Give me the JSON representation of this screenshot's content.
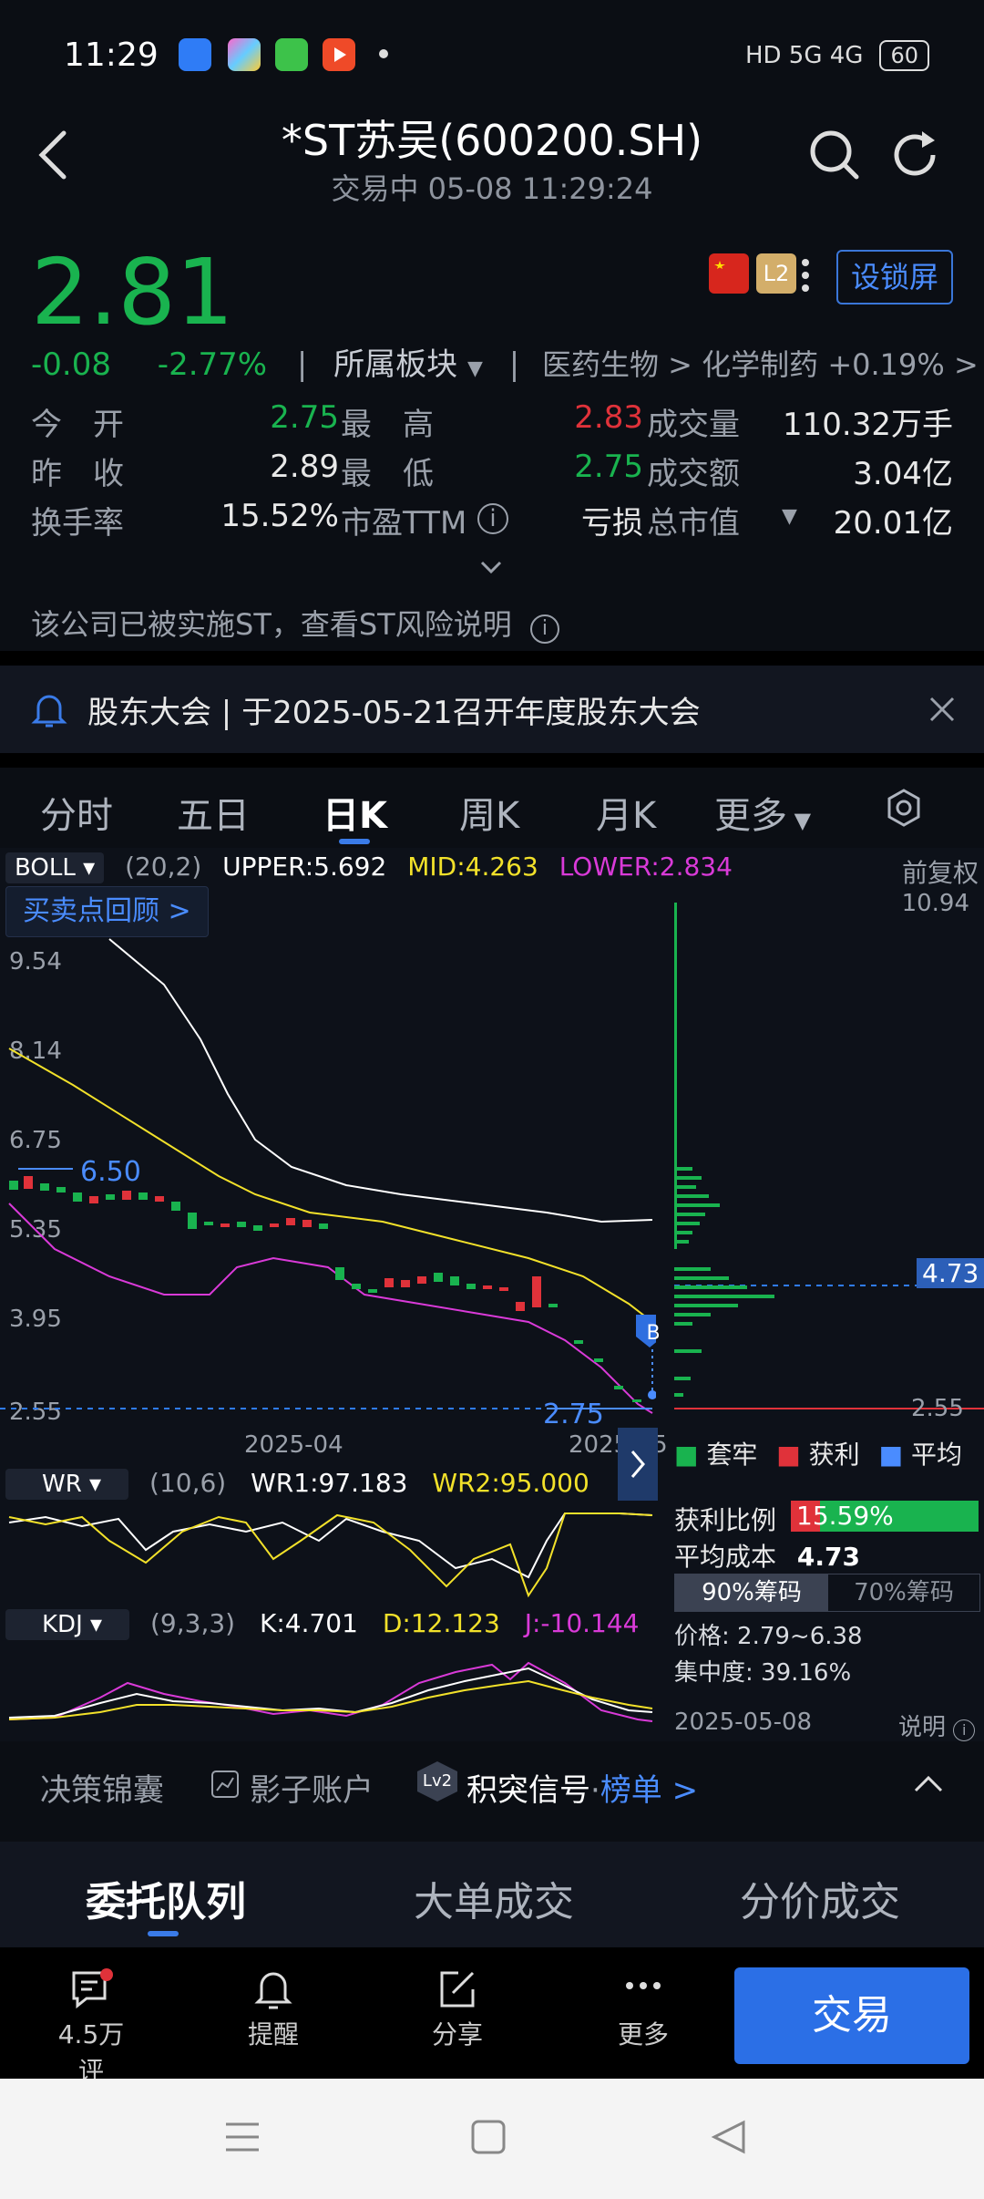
{
  "status_bar": {
    "time": "11:29",
    "network": "HD 5G 4G",
    "battery": "60",
    "app_icons": [
      "blue-app-icon",
      "colorful-app-icon",
      "green-app-icon",
      "red-video-app-icon",
      "dot-icon"
    ]
  },
  "header": {
    "title": "*ST苏吴(600200.SH)",
    "subtitle": "交易中 05-08 11:29:24"
  },
  "quote": {
    "price": "2.81",
    "change": "-0.08",
    "change_pct": "-2.77%",
    "sector_label": "所属板块",
    "sector_path": "医药生物 > 化学制药 +0.19% >",
    "l2_badge": "L2",
    "lock_screen": "设锁屏",
    "rows": [
      {
        "l1": "今　开",
        "v1": "2.75",
        "l2": "最　高",
        "v2": "2.83",
        "l3": "成交量",
        "v3": "110.32万手"
      },
      {
        "l1": "昨　收",
        "v1": "2.89",
        "l2": "最　低",
        "v2": "2.75",
        "l3": "成交额",
        "v3": "3.04亿"
      },
      {
        "l1": "换手率",
        "v1": "15.52%",
        "l2": "市盈TTM",
        "v2": "亏损",
        "l3": "总市值",
        "v3": "20.01亿"
      }
    ],
    "st_notice": "该公司已被实施ST，查看ST风险说明"
  },
  "meeting": {
    "text": "股东大会 | 于2025-05-21召开年度股东大会"
  },
  "tabs": [
    "分时",
    "五日",
    "日K",
    "周K",
    "月K",
    "更多"
  ],
  "chart": {
    "boll": {
      "name": "BOLL",
      "params": "(20,2)",
      "upper": "UPPER:5.692",
      "mid": "MID:4.263",
      "lower": "LOWER:2.834"
    },
    "adjust": "前复权",
    "review": "买卖点回顾 >",
    "y_ticks": [
      "10.94",
      "9.54",
      "8.14",
      "6.75",
      "5.35",
      "3.95",
      "2.55"
    ],
    "x_ticks": [
      "2025-04",
      "2025-05"
    ],
    "mark_650": "6.50",
    "mark_275": "2.75",
    "avg_cost_tag": "4.73",
    "low_tag": "2.55",
    "b_marker": "B",
    "legend": [
      "套牢",
      "获利",
      "平均"
    ],
    "chip": {
      "profit_label": "获利比例",
      "profit_value": "15.59%",
      "profit_ratio": 0.1559,
      "avg_label": "平均成本",
      "avg_value": "4.73",
      "tab90": "90%筹码",
      "tab70": "70%筹码",
      "range": "价格: 2.79~6.38",
      "concentration": "集中度: 39.16%",
      "date": "2025-05-08",
      "explain": "说明"
    },
    "wr": {
      "name": "WR",
      "params": "(10,6)",
      "wr1": "WR1:97.183",
      "wr2": "WR2:95.000"
    },
    "kdj": {
      "name": "KDJ",
      "params": "(9,3,3)",
      "k": "K:4.701",
      "d": "D:12.123",
      "j": "J:-10.144"
    }
  },
  "tools": {
    "decision": "决策锦囊",
    "shadow": "影子账户",
    "lv2": "Lv2",
    "signal": "积突信号",
    "signal_dot": "·",
    "rank": "榜单 >"
  },
  "bottom_tabs": [
    "委托队列",
    "大单成交",
    "分价成交"
  ],
  "actions": {
    "comments": "4.5万评",
    "remind": "提醒",
    "share": "分享",
    "more": "更多",
    "trade": "交易"
  },
  "colors": {
    "up": "#e0323a",
    "down": "#19b34f",
    "accent": "#2b6fe6"
  }
}
